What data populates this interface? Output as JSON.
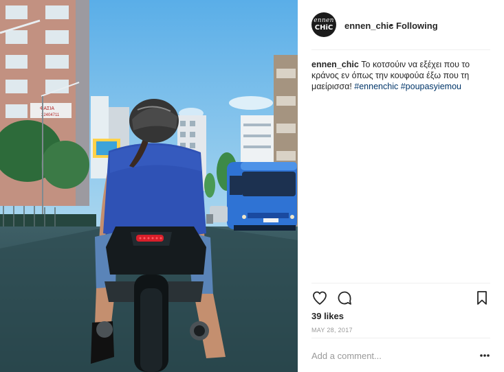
{
  "post": {
    "username": "ennen_chic",
    "separator": "•",
    "follow_status": "Following",
    "avatar": {
      "line1": "ennen",
      "line2": "CHiC"
    },
    "caption": {
      "username": "ennen_chic",
      "text": "Το κοτσούιν να εξέχει που το κράνος εν όπως την κουφούα έξω που τη μαείρισσα!",
      "hashtags": [
        "#ennenchic",
        "#poupasyiemou"
      ]
    },
    "likes": "39 likes",
    "date": "MAY 28, 2017",
    "comment_placeholder": "Add a comment..."
  },
  "photo_signs": {
    "shop_sign_1": "ΦΑΣΙΑ",
    "shop_sign_2": "22404711"
  },
  "icons": {
    "like": "heart-outline-icon",
    "comment": "speech-bubble-icon",
    "save": "bookmark-icon",
    "more": "ellipsis-icon"
  },
  "colors": {
    "text": "#262626",
    "muted": "#999999",
    "hashtag": "#003569",
    "divider": "#efefef",
    "sky": "#6fb6e6",
    "bus": "#2f73d4",
    "shirt": "#2f52b5"
  }
}
